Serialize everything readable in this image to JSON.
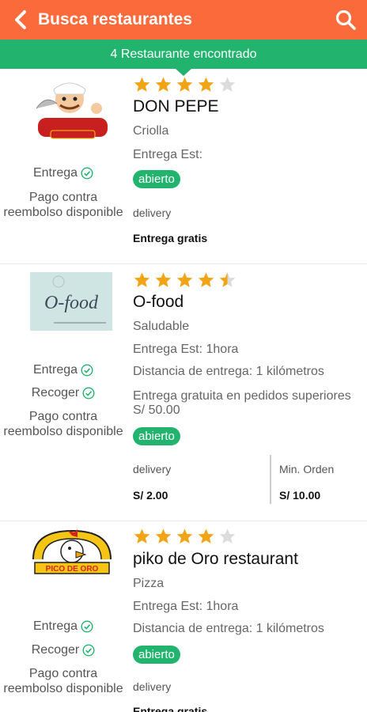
{
  "appbar": {
    "title": "Busca restaurantes",
    "back_icon": "back-arrow-icon",
    "search_icon": "search-icon"
  },
  "banner": {
    "text": "4 Restaurante encontrado"
  },
  "colors": {
    "header": "#fb6a3a",
    "accent": "#22b46e",
    "star": "#f2a417"
  },
  "restaurants": [
    {
      "logo_icon": "mr-bolat-logo",
      "rating": 4,
      "name": "DON PEPE",
      "category": "Criolla",
      "delivery_time": "Entrega Est:",
      "status": "abierto",
      "services": [
        "Entrega"
      ],
      "payment": "Pago contra reembolso disponible",
      "delivery_label": "delivery",
      "delivery_value": "Entrega gratis"
    },
    {
      "logo_icon": "o-food-logo",
      "logo_text": "O-food",
      "rating": 4.5,
      "name": "O-food",
      "category": "Saludable",
      "delivery_time": "Entrega Est: 1hora",
      "distance": "Distancia de entrega: 1 kilómetros",
      "free_delivery_note": "Entrega gratuita en pedidos superiores S/ 50.00",
      "status": "abierto",
      "services": [
        "Entrega",
        "Recoger"
      ],
      "payment": "Pago contra reembolso disponible",
      "delivery_label": "delivery",
      "delivery_value": "S/ 2.00",
      "min_order_label": "Min. Orden",
      "min_order_value": "S/ 10.00"
    },
    {
      "logo_icon": "pico-de-oro-logo",
      "logo_text": "PICO DE ORO",
      "rating": 4,
      "name": "piko de Oro restaurant",
      "category": "Pizza",
      "delivery_time": "Entrega Est: 1hora",
      "distance": "Distancia de entrega: 1 kilómetros",
      "status": "abierto",
      "services": [
        "Entrega",
        "Recoger"
      ],
      "payment": "Pago contra reembolso disponible",
      "delivery_label": "delivery",
      "delivery_value": "Entrega gratis"
    }
  ]
}
